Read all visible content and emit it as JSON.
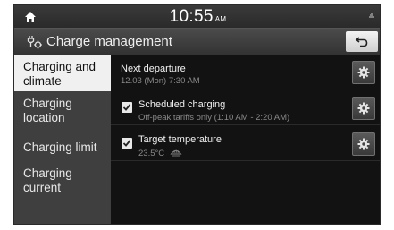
{
  "status": {
    "time": "10:55",
    "ampm": "AM"
  },
  "header": {
    "title": "Charge management"
  },
  "sidebar": {
    "items": [
      {
        "label": "Charging and climate"
      },
      {
        "label": "Charging location"
      },
      {
        "label": "Charging limit"
      },
      {
        "label": "Charging current"
      }
    ]
  },
  "content": {
    "next_departure": {
      "label": "Next departure",
      "detail": "12.03 (Mon) 7:30 AM"
    },
    "scheduled_charging": {
      "label": "Scheduled charging",
      "detail": "Off-peak tariffs only (1:10 AM - 2:20 AM)",
      "checked": true
    },
    "target_temperature": {
      "label": "Target temperature",
      "detail": "23.5°C",
      "checked": true
    }
  },
  "icons": {
    "home": "home-icon",
    "signal": "signal-icon",
    "title": "charge-management-icon",
    "back": "back-arrow-icon",
    "gear": "gear-icon",
    "check": "check-icon",
    "defrost": "defrost-icon"
  }
}
